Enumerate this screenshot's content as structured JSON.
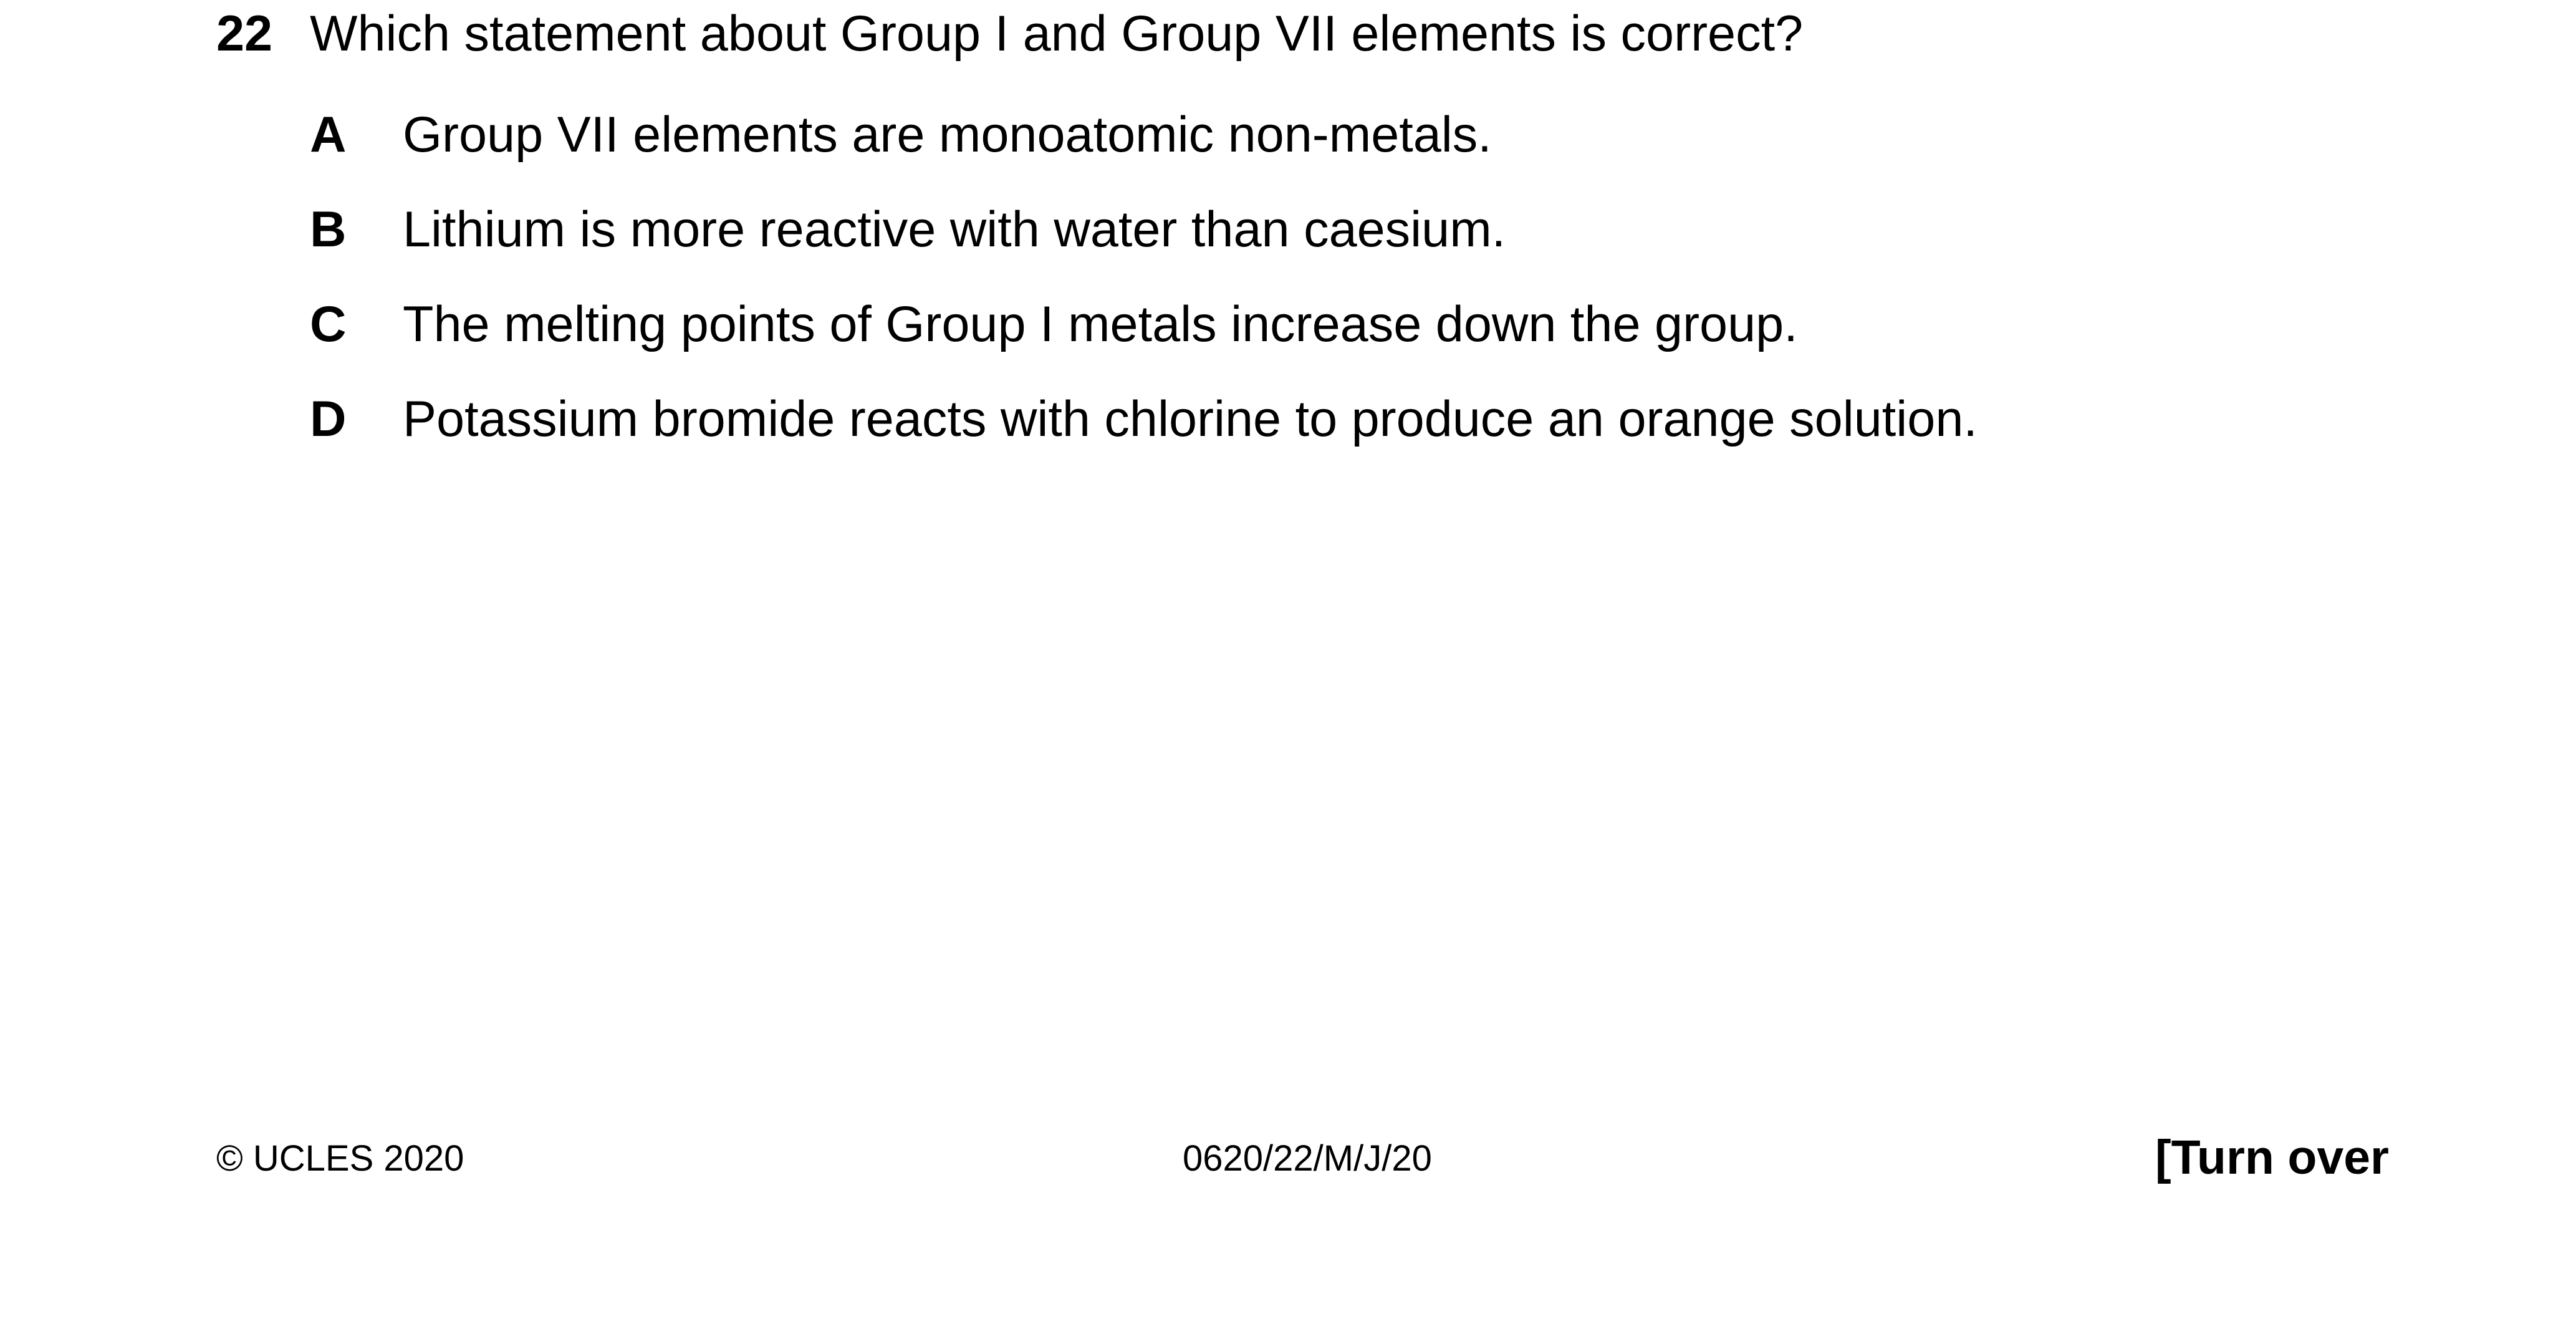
{
  "question": {
    "number": "22",
    "stem": "Which statement about Group I and Group VII elements is correct?",
    "options": [
      {
        "letter": "A",
        "text": "Group VII elements are monoatomic non-metals."
      },
      {
        "letter": "B",
        "text": "Lithium is more reactive with water than caesium."
      },
      {
        "letter": "C",
        "text": "The melting points of Group I metals increase down the group."
      },
      {
        "letter": "D",
        "text": "Potassium bromide reacts with chlorine to produce an orange solution."
      }
    ]
  },
  "footer": {
    "copyright": "© UCLES 2020",
    "paper_code": "0620/22/M/J/20",
    "turn_over": "[Turn over"
  }
}
